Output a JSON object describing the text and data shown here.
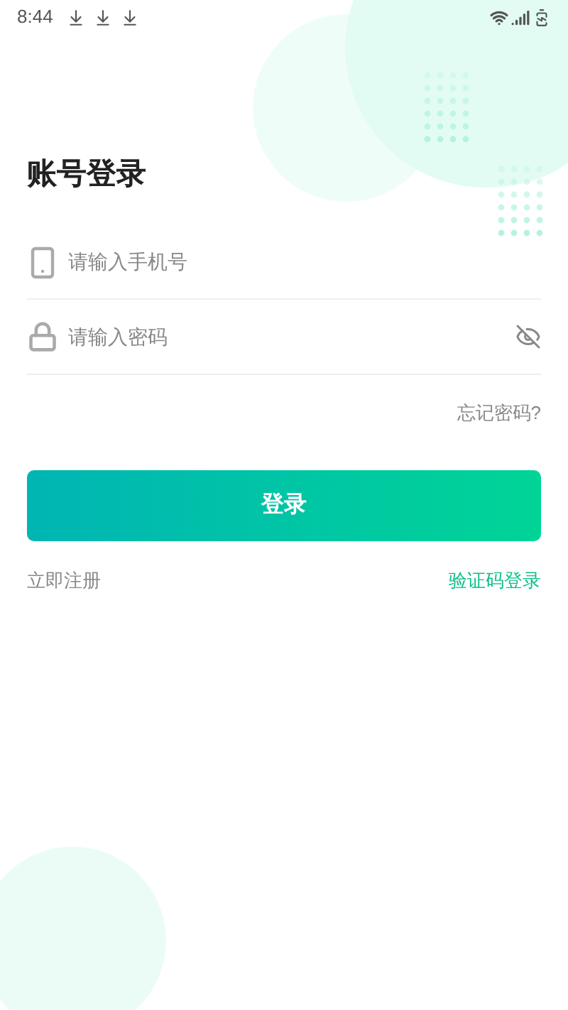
{
  "status_bar": {
    "time": "8:44"
  },
  "title": "账号登录",
  "phone_field": {
    "placeholder": "请输入手机号"
  },
  "password_field": {
    "placeholder": "请输入密码",
    "visible": false
  },
  "forgot_link": "忘记密码?",
  "login_button": "登录",
  "register_link": "立即注册",
  "sms_login_link": "验证码登录"
}
